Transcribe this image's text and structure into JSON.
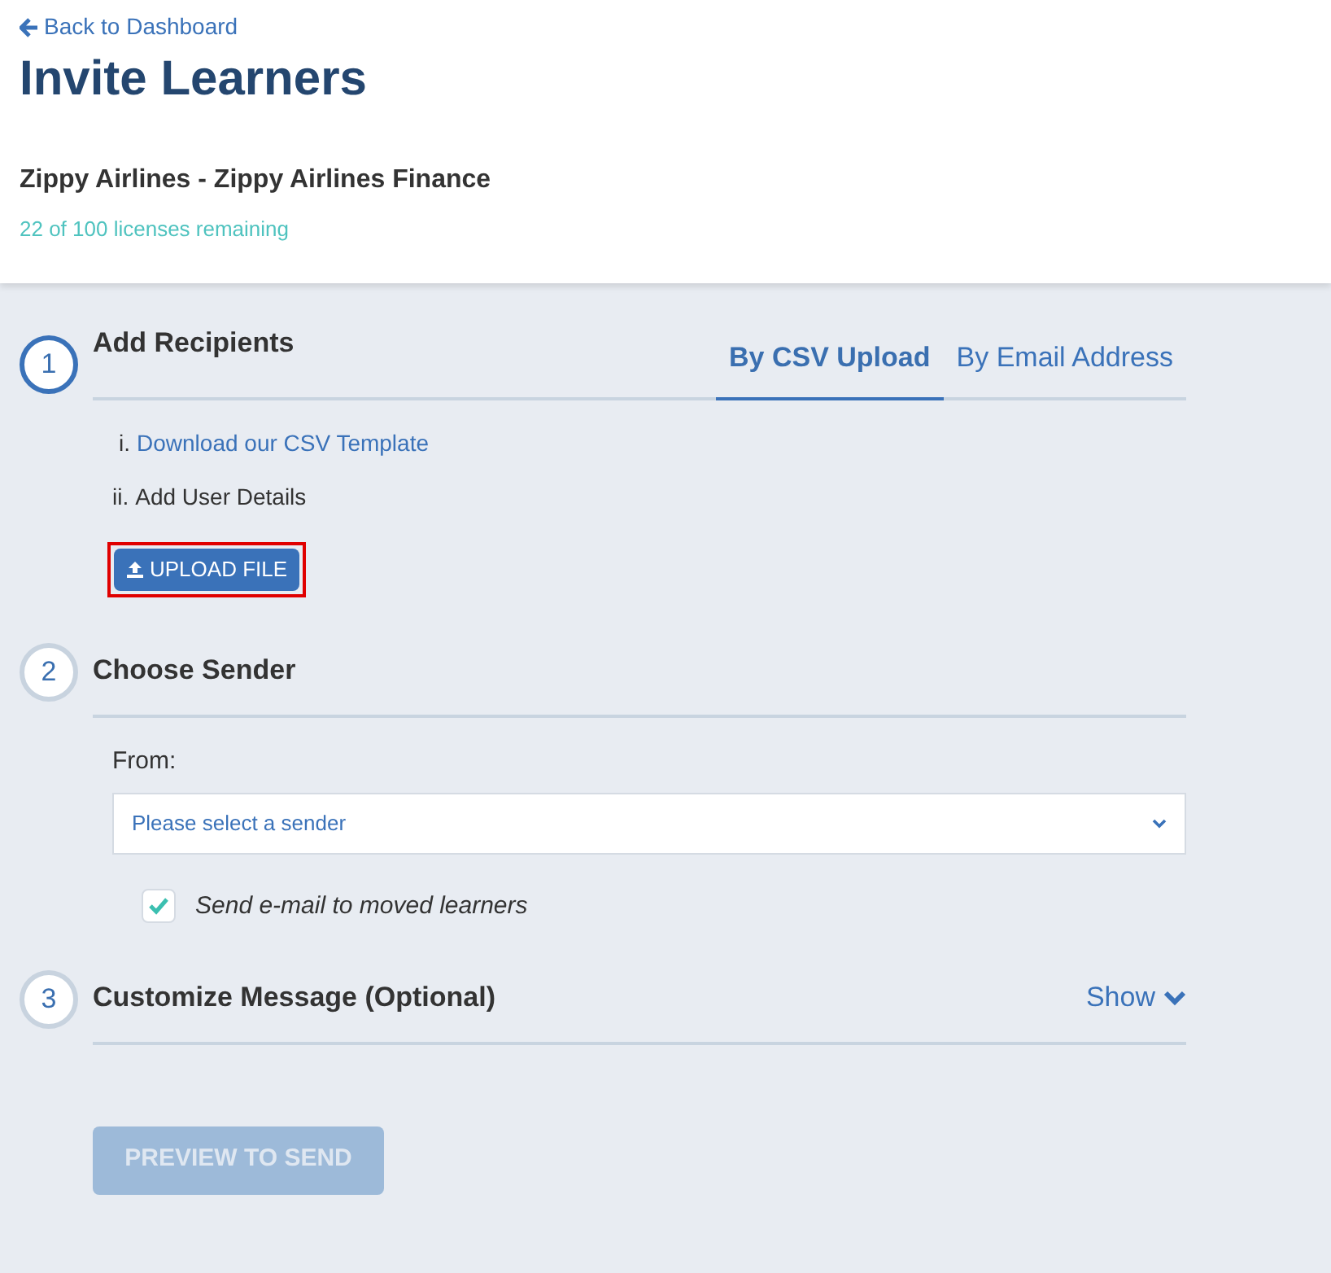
{
  "back_link": "Back to Dashboard",
  "title": "Invite Learners",
  "organization": "Zippy Airlines - Zippy Airlines Finance",
  "licenses": "22 of 100 licenses remaining",
  "steps": [
    {
      "kind": "recipients",
      "number": "1",
      "title": "Add Recipients",
      "active": true,
      "tabs": [
        {
          "label": "By CSV Upload",
          "selected": true
        },
        {
          "label": "By Email Address",
          "selected": false
        }
      ],
      "instructions": [
        {
          "marker": "i.",
          "text": "Download our CSV Template",
          "link": true
        },
        {
          "marker": "ii.",
          "text": "Add User Details",
          "link": false
        }
      ],
      "upload_button": {
        "label": "UPLOAD FILE",
        "highlighted": true
      }
    },
    {
      "kind": "sender",
      "number": "2",
      "title": "Choose Sender",
      "active": false,
      "from_label": "From:",
      "select": {
        "placeholder": "Please select a sender"
      },
      "checkbox": {
        "label": "Send e-mail to moved learners",
        "checked": true
      }
    },
    {
      "kind": "message",
      "number": "3",
      "title": "Customize Message (Optional)",
      "active": false,
      "toggle": {
        "label": "Show",
        "expanded": false
      }
    }
  ],
  "submit": {
    "label": "PREVIEW TO SEND",
    "disabled": true
  }
}
